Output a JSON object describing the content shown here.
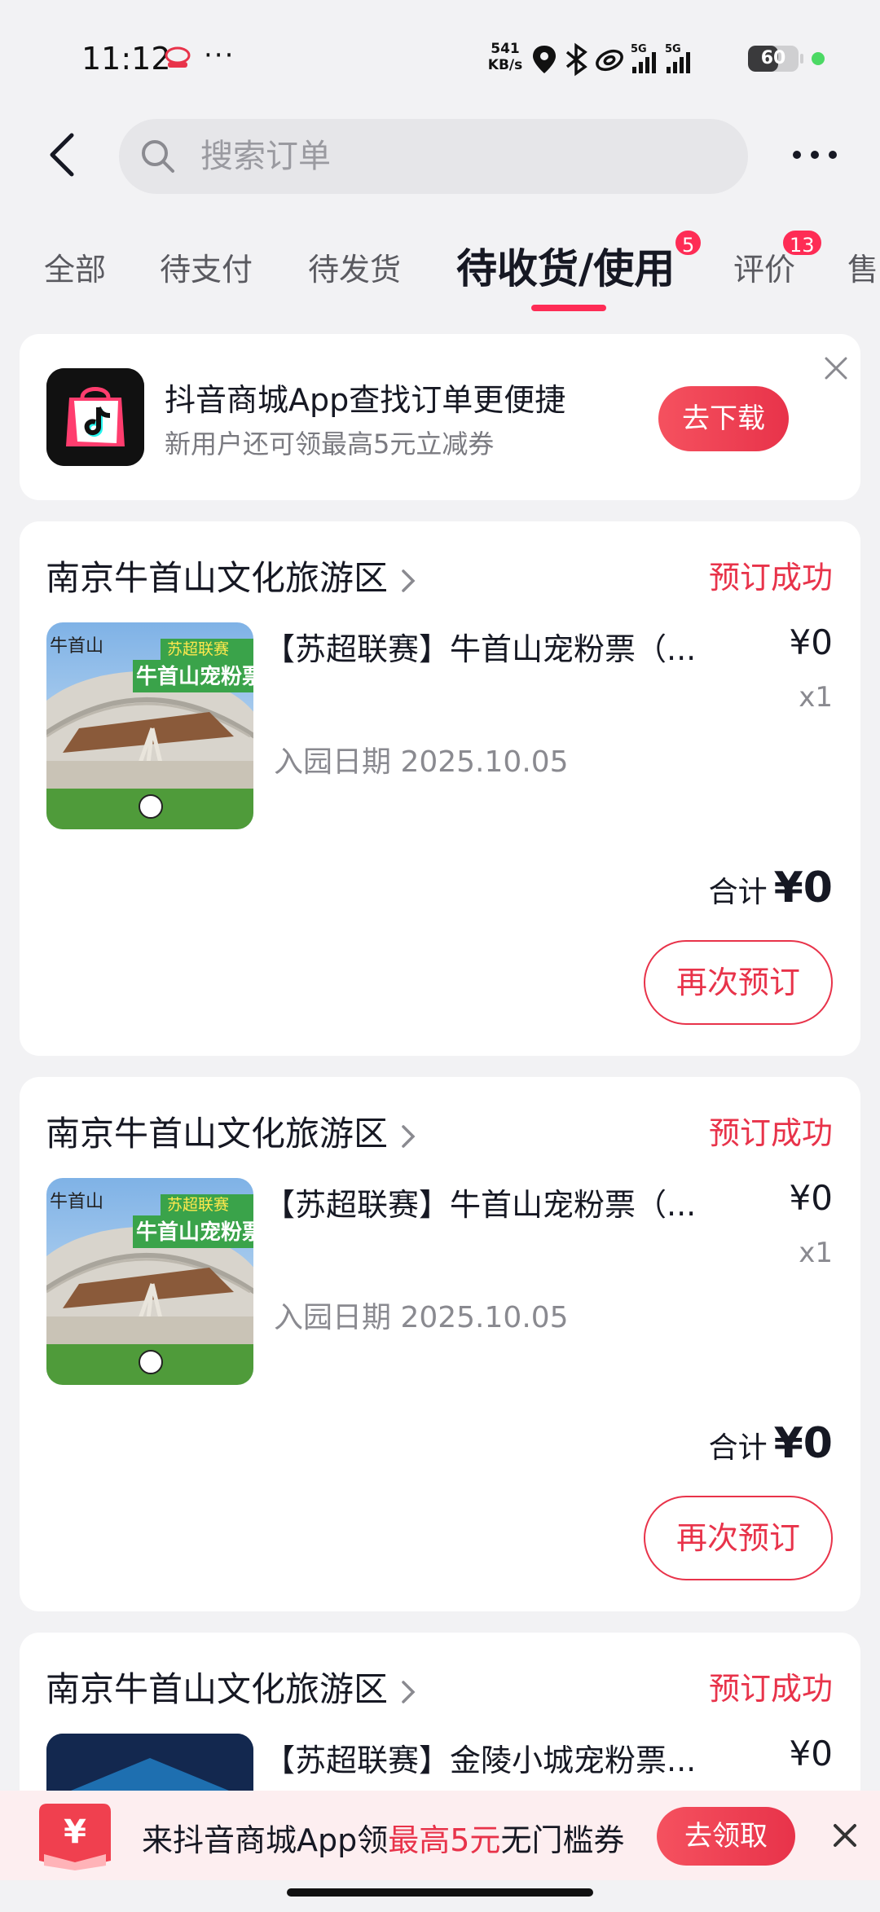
{
  "status_bar": {
    "time": "11:12",
    "menu_dots": "···",
    "net_speed_value": "541",
    "net_speed_unit": "KB/s",
    "battery": "60",
    "battery_level": 0.6
  },
  "header": {
    "search_placeholder": "搜索订单"
  },
  "tabs": [
    {
      "label": "全部"
    },
    {
      "label": "待支付"
    },
    {
      "label": "待发货"
    },
    {
      "label": "待收货/使用",
      "badge": "5",
      "active": true
    },
    {
      "label": "评价",
      "badge": "13"
    },
    {
      "label": "售"
    }
  ],
  "promo": {
    "title": "抖音商城App查找订单更便捷",
    "subtitle": "新用户还可领最高5元立减券",
    "button": "去下载"
  },
  "orders": [
    {
      "shop": "南京牛首山文化旅游区",
      "status": "预订成功",
      "title": "【苏超联赛】牛首山宠粉票（...",
      "price": "¥0",
      "qty": "x1",
      "date": "入园日期 2025.10.05",
      "total_label": "合计",
      "total": "¥0",
      "action": "再次预订",
      "thumb_badge": "苏超联赛",
      "thumb_title": "牛首山宠粉票",
      "thumb_logo": "牛首山"
    },
    {
      "shop": "南京牛首山文化旅游区",
      "status": "预订成功",
      "title": "【苏超联赛】牛首山宠粉票（...",
      "price": "¥0",
      "qty": "x1",
      "date": "入园日期 2025.10.05",
      "total_label": "合计",
      "total": "¥0",
      "action": "再次预订",
      "thumb_badge": "苏超联赛",
      "thumb_title": "牛首山宠粉票",
      "thumb_logo": "牛首山"
    },
    {
      "shop": "南京牛首山文化旅游区",
      "status": "预订成功",
      "title": "【苏超联赛】金陵小城宠粉票...",
      "price": "¥0"
    }
  ],
  "bottom_banner": {
    "text_before": "来抖音商城App领",
    "text_highlight": "最高5元",
    "text_after": "无门槛券",
    "button": "去领取"
  },
  "colors": {
    "accent": "#e8334a",
    "badge": "#fe2c55",
    "background": "#f2f2f4"
  }
}
